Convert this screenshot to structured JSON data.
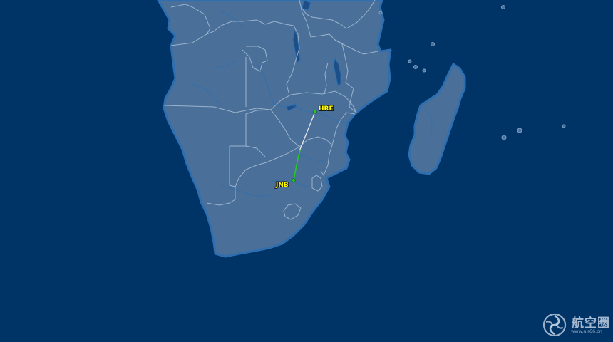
{
  "map": {
    "region": "Southern Africa",
    "colors": {
      "ocean": "#003366",
      "land": "#4a6f99",
      "border": "#a9bfd6",
      "coast": "#2d6fb0",
      "flown_track": "#22cc22",
      "planned_route": "#e8e8e8",
      "airport_label": "#ffff00"
    }
  },
  "flight": {
    "origin": {
      "code": "JNB"
    },
    "destination": {
      "code": "HRE"
    }
  },
  "watermark": {
    "title": "航空圈",
    "url": "www.air66.cn",
    "icon": "air66-swirl-logo"
  }
}
